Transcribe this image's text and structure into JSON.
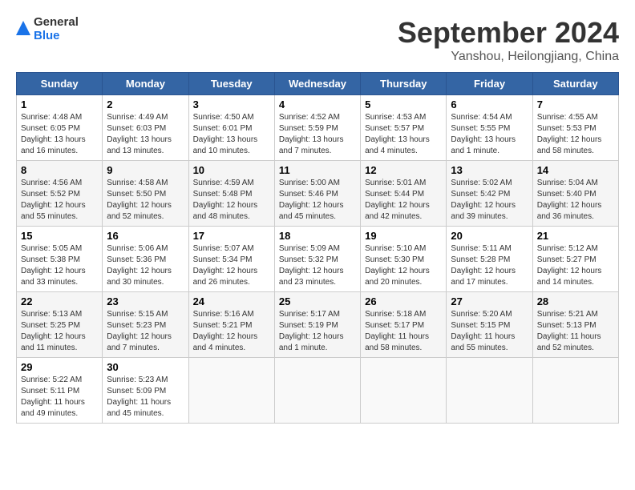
{
  "header": {
    "logo_general": "General",
    "logo_blue": "Blue",
    "month_title": "September 2024",
    "location": "Yanshou, Heilongjiang, China"
  },
  "columns": [
    "Sunday",
    "Monday",
    "Tuesday",
    "Wednesday",
    "Thursday",
    "Friday",
    "Saturday"
  ],
  "weeks": [
    [
      {
        "day": "1",
        "info": "Sunrise: 4:48 AM\nSunset: 6:05 PM\nDaylight: 13 hours and 16 minutes."
      },
      {
        "day": "2",
        "info": "Sunrise: 4:49 AM\nSunset: 6:03 PM\nDaylight: 13 hours and 13 minutes."
      },
      {
        "day": "3",
        "info": "Sunrise: 4:50 AM\nSunset: 6:01 PM\nDaylight: 13 hours and 10 minutes."
      },
      {
        "day": "4",
        "info": "Sunrise: 4:52 AM\nSunset: 5:59 PM\nDaylight: 13 hours and 7 minutes."
      },
      {
        "day": "5",
        "info": "Sunrise: 4:53 AM\nSunset: 5:57 PM\nDaylight: 13 hours and 4 minutes."
      },
      {
        "day": "6",
        "info": "Sunrise: 4:54 AM\nSunset: 5:55 PM\nDaylight: 13 hours and 1 minute."
      },
      {
        "day": "7",
        "info": "Sunrise: 4:55 AM\nSunset: 5:53 PM\nDaylight: 12 hours and 58 minutes."
      }
    ],
    [
      {
        "day": "8",
        "info": "Sunrise: 4:56 AM\nSunset: 5:52 PM\nDaylight: 12 hours and 55 minutes."
      },
      {
        "day": "9",
        "info": "Sunrise: 4:58 AM\nSunset: 5:50 PM\nDaylight: 12 hours and 52 minutes."
      },
      {
        "day": "10",
        "info": "Sunrise: 4:59 AM\nSunset: 5:48 PM\nDaylight: 12 hours and 48 minutes."
      },
      {
        "day": "11",
        "info": "Sunrise: 5:00 AM\nSunset: 5:46 PM\nDaylight: 12 hours and 45 minutes."
      },
      {
        "day": "12",
        "info": "Sunrise: 5:01 AM\nSunset: 5:44 PM\nDaylight: 12 hours and 42 minutes."
      },
      {
        "day": "13",
        "info": "Sunrise: 5:02 AM\nSunset: 5:42 PM\nDaylight: 12 hours and 39 minutes."
      },
      {
        "day": "14",
        "info": "Sunrise: 5:04 AM\nSunset: 5:40 PM\nDaylight: 12 hours and 36 minutes."
      }
    ],
    [
      {
        "day": "15",
        "info": "Sunrise: 5:05 AM\nSunset: 5:38 PM\nDaylight: 12 hours and 33 minutes."
      },
      {
        "day": "16",
        "info": "Sunrise: 5:06 AM\nSunset: 5:36 PM\nDaylight: 12 hours and 30 minutes."
      },
      {
        "day": "17",
        "info": "Sunrise: 5:07 AM\nSunset: 5:34 PM\nDaylight: 12 hours and 26 minutes."
      },
      {
        "day": "18",
        "info": "Sunrise: 5:09 AM\nSunset: 5:32 PM\nDaylight: 12 hours and 23 minutes."
      },
      {
        "day": "19",
        "info": "Sunrise: 5:10 AM\nSunset: 5:30 PM\nDaylight: 12 hours and 20 minutes."
      },
      {
        "day": "20",
        "info": "Sunrise: 5:11 AM\nSunset: 5:28 PM\nDaylight: 12 hours and 17 minutes."
      },
      {
        "day": "21",
        "info": "Sunrise: 5:12 AM\nSunset: 5:27 PM\nDaylight: 12 hours and 14 minutes."
      }
    ],
    [
      {
        "day": "22",
        "info": "Sunrise: 5:13 AM\nSunset: 5:25 PM\nDaylight: 12 hours and 11 minutes."
      },
      {
        "day": "23",
        "info": "Sunrise: 5:15 AM\nSunset: 5:23 PM\nDaylight: 12 hours and 7 minutes."
      },
      {
        "day": "24",
        "info": "Sunrise: 5:16 AM\nSunset: 5:21 PM\nDaylight: 12 hours and 4 minutes."
      },
      {
        "day": "25",
        "info": "Sunrise: 5:17 AM\nSunset: 5:19 PM\nDaylight: 12 hours and 1 minute."
      },
      {
        "day": "26",
        "info": "Sunrise: 5:18 AM\nSunset: 5:17 PM\nDaylight: 11 hours and 58 minutes."
      },
      {
        "day": "27",
        "info": "Sunrise: 5:20 AM\nSunset: 5:15 PM\nDaylight: 11 hours and 55 minutes."
      },
      {
        "day": "28",
        "info": "Sunrise: 5:21 AM\nSunset: 5:13 PM\nDaylight: 11 hours and 52 minutes."
      }
    ],
    [
      {
        "day": "29",
        "info": "Sunrise: 5:22 AM\nSunset: 5:11 PM\nDaylight: 11 hours and 49 minutes."
      },
      {
        "day": "30",
        "info": "Sunrise: 5:23 AM\nSunset: 5:09 PM\nDaylight: 11 hours and 45 minutes."
      },
      {
        "day": "",
        "info": ""
      },
      {
        "day": "",
        "info": ""
      },
      {
        "day": "",
        "info": ""
      },
      {
        "day": "",
        "info": ""
      },
      {
        "day": "",
        "info": ""
      }
    ]
  ]
}
